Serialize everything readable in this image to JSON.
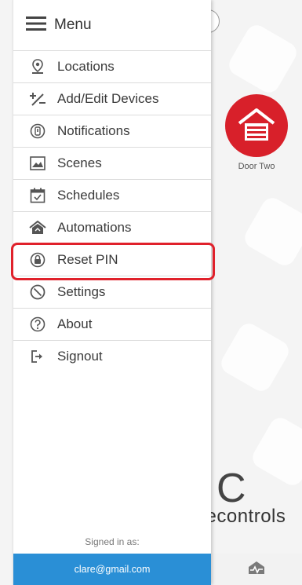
{
  "drawer": {
    "title": "Menu",
    "items": [
      {
        "label": "Locations",
        "icon": "location-pin-icon"
      },
      {
        "label": "Add/Edit Devices",
        "icon": "add-edit-icon"
      },
      {
        "label": "Notifications",
        "icon": "notification-icon"
      },
      {
        "label": "Scenes",
        "icon": "scene-icon"
      },
      {
        "label": "Schedules",
        "icon": "calendar-icon"
      },
      {
        "label": "Automations",
        "icon": "home-automation-icon"
      },
      {
        "label": "Reset PIN",
        "icon": "lock-icon"
      },
      {
        "label": "Settings",
        "icon": "settings-icon"
      },
      {
        "label": "About",
        "icon": "help-icon"
      },
      {
        "label": "Signout",
        "icon": "signout-icon"
      }
    ],
    "signed_in_label": "Signed in as:",
    "account_email": "clare@gmail.com"
  },
  "background": {
    "device_label": "Door Two",
    "brand_logo_glyph": "C",
    "brand_text": "recontrols"
  },
  "colors": {
    "accent_blue": "#2a8fd6",
    "highlight_red": "#e0212b",
    "device_red": "#d8202a"
  }
}
